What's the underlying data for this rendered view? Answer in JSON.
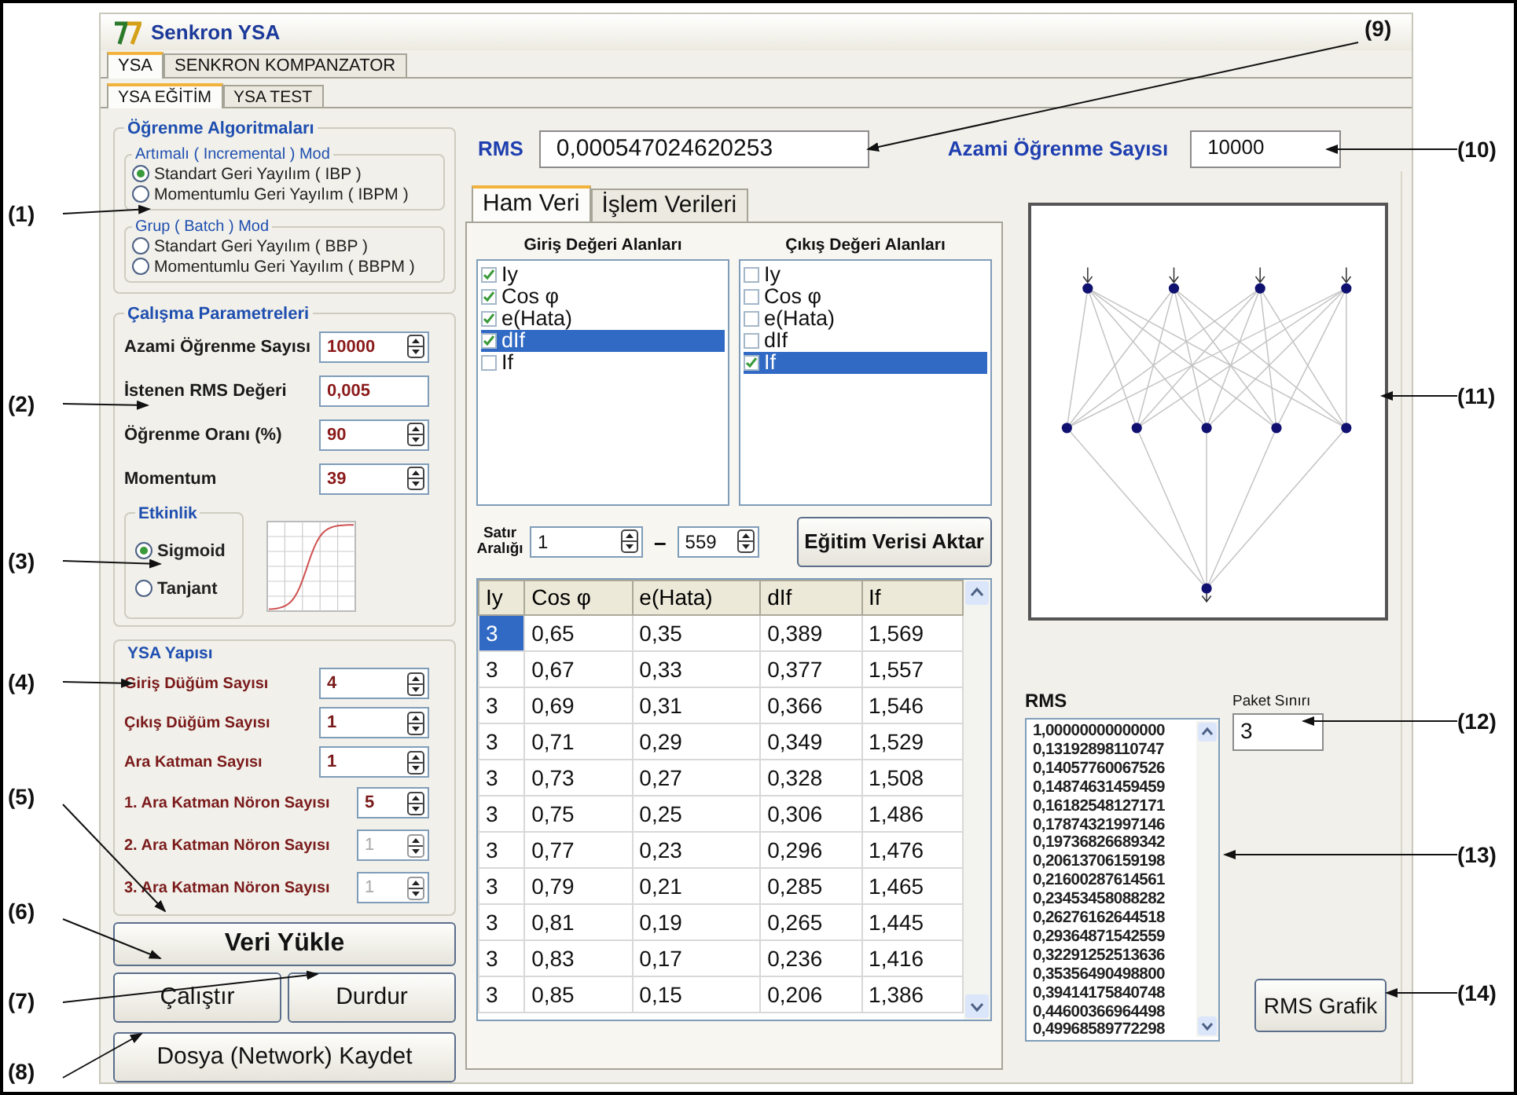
{
  "window": {
    "title": "Senkron YSA"
  },
  "main_tabs": [
    {
      "label": "YSA",
      "selected": true
    },
    {
      "label": "SENKRON KOMPANZATOR",
      "selected": false
    }
  ],
  "sub_tabs": [
    {
      "label": "YSA EĞİTİM",
      "selected": true
    },
    {
      "label": "YSA TEST",
      "selected": false
    }
  ],
  "learning_algorithms": {
    "title": "Öğrenme Algoritmaları",
    "groups": [
      {
        "title": "Artımalı ( Incremental ) Mod",
        "options": [
          {
            "label": "Standart Geri Yayılım ( IBP )",
            "selected": true
          },
          {
            "label": "Momentumlu Geri Yayılım ( IBPM )",
            "selected": false
          }
        ]
      },
      {
        "title": "Grup ( Batch ) Mod",
        "options": [
          {
            "label": "Standart Geri Yayılım ( BBP )",
            "selected": false
          },
          {
            "label": "Momentumlu Geri Yayılım ( BBPM )",
            "selected": false
          }
        ]
      }
    ]
  },
  "parameters": {
    "title": "Çalışma Parametreleri",
    "fields": [
      {
        "label": "Azami Öğrenme Sayısı",
        "value": "10000",
        "kind": "spinner"
      },
      {
        "label": "İstenen RMS Değeri",
        "value": "0,005",
        "kind": "text"
      },
      {
        "label": "Öğrenme Oranı (%)",
        "value": "90",
        "kind": "spinner"
      },
      {
        "label": "Momentum",
        "value": "39",
        "kind": "spinner"
      }
    ]
  },
  "activation": {
    "title": "Etkinlik",
    "options": [
      {
        "label": "Sigmoid",
        "selected": true
      },
      {
        "label": "Tanjant",
        "selected": false
      }
    ]
  },
  "structure": {
    "title": "YSA Yapısı",
    "fields": [
      {
        "label": "Giriş Düğüm Sayısı",
        "value": "4",
        "disabled": false,
        "kind": "wide"
      },
      {
        "label": "Çıkış Düğüm Sayısı",
        "value": "1",
        "disabled": false,
        "kind": "wide"
      },
      {
        "label": "Ara Katman Sayısı",
        "value": "1",
        "disabled": false,
        "kind": "wide"
      },
      {
        "label": "1. Ara Katman Nöron Sayısı",
        "value": "5",
        "disabled": false,
        "kind": "narrow"
      },
      {
        "label": "2. Ara Katman Nöron Sayısı",
        "value": "1",
        "disabled": true,
        "kind": "narrow"
      },
      {
        "label": "3. Ara Katman Nöron Sayısı",
        "value": "1",
        "disabled": true,
        "kind": "narrow"
      }
    ]
  },
  "buttons": {
    "load": "Veri Yükle",
    "run": "Çalıştır",
    "stop": "Durdur",
    "save": "Dosya (Network) Kaydet"
  },
  "rms": {
    "label": "RMS",
    "value": "0,000547024620253"
  },
  "max_iterations": {
    "label": "Azami Öğrenme Sayısı",
    "value": "10000"
  },
  "data_tabs": [
    {
      "label": "Ham Veri",
      "selected": true
    },
    {
      "label": "İşlem Verileri",
      "selected": false
    }
  ],
  "input_fields": {
    "title": "Giriş Değeri Alanları",
    "items": [
      {
        "label": "Iy",
        "checked": true,
        "selected": false
      },
      {
        "label": "Cos φ",
        "checked": true,
        "selected": false
      },
      {
        "label": "e(Hata)",
        "checked": true,
        "selected": false
      },
      {
        "label": "dIf",
        "checked": true,
        "selected": true
      },
      {
        "label": "If",
        "checked": false,
        "selected": false
      }
    ]
  },
  "output_fields": {
    "title": "Çıkış Değeri Alanları",
    "items": [
      {
        "label": "Iy",
        "checked": false,
        "selected": false
      },
      {
        "label": "Cos φ",
        "checked": false,
        "selected": false
      },
      {
        "label": "e(Hata)",
        "checked": false,
        "selected": false
      },
      {
        "label": "dIf",
        "checked": false,
        "selected": false
      },
      {
        "label": "If",
        "checked": true,
        "selected": true
      }
    ]
  },
  "row_range": {
    "label": "Satır Aralığı",
    "from": "1",
    "separator": "–",
    "to": "559"
  },
  "transfer_button": "Eğitim Verisi Aktar",
  "table": {
    "columns": [
      "Iy",
      "Cos φ",
      "e(Hata)",
      "dIf",
      "If"
    ],
    "rows": [
      {
        "cells": [
          "3",
          "0,65",
          "0,35",
          "0,389",
          "1,569"
        ],
        "selected": true
      },
      {
        "cells": [
          "3",
          "0,67",
          "0,33",
          "0,377",
          "1,557"
        ],
        "selected": false
      },
      {
        "cells": [
          "3",
          "0,69",
          "0,31",
          "0,366",
          "1,546"
        ],
        "selected": false
      },
      {
        "cells": [
          "3",
          "0,71",
          "0,29",
          "0,349",
          "1,529"
        ],
        "selected": false
      },
      {
        "cells": [
          "3",
          "0,73",
          "0,27",
          "0,328",
          "1,508"
        ],
        "selected": false
      },
      {
        "cells": [
          "3",
          "0,75",
          "0,25",
          "0,306",
          "1,486"
        ],
        "selected": false
      },
      {
        "cells": [
          "3",
          "0,77",
          "0,23",
          "0,296",
          "1,476"
        ],
        "selected": false
      },
      {
        "cells": [
          "3",
          "0,79",
          "0,21",
          "0,285",
          "1,465"
        ],
        "selected": false
      },
      {
        "cells": [
          "3",
          "0,81",
          "0,19",
          "0,265",
          "1,445"
        ],
        "selected": false
      },
      {
        "cells": [
          "3",
          "0,83",
          "0,17",
          "0,236",
          "1,416"
        ],
        "selected": false
      },
      {
        "cells": [
          "3",
          "0,85",
          "0,15",
          "0,206",
          "1,386"
        ],
        "selected": false
      }
    ]
  },
  "rms_history": {
    "label": "RMS",
    "values": [
      "1,00000000000000",
      "0,13192898110747",
      "0,14057760067526",
      "0,14874631459459",
      "0,16182548127171",
      "0,17874321997146",
      "0,19736826689342",
      "0,20613706159198",
      "0,21600287614561",
      "0,23453458088282",
      "0,26276162644518",
      "0,29364871542559",
      "0,32291252513636",
      "0,35356490498800",
      "0,39414175840748",
      "0,44600366964498",
      "0,49968589772298"
    ]
  },
  "batch_limit": {
    "label": "Paket Sınırı",
    "value": "3"
  },
  "graph_button": "RMS Grafik",
  "callouts": [
    "(1)",
    "(2)",
    "(3)",
    "(4)",
    "(5)",
    "(6)",
    "(7)",
    "(8)",
    "(9)",
    "(10)",
    "(11)",
    "(12)",
    "(13)",
    "(14)"
  ]
}
